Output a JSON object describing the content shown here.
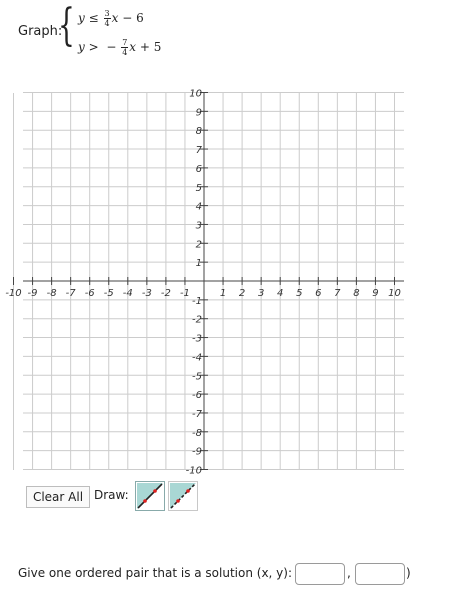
{
  "question": {
    "graph_label": "Graph:",
    "inequality_1": {
      "lhs": "y",
      "op": "≤",
      "num": "3",
      "den": "4",
      "var": "x",
      "rest": "− 6"
    },
    "inequality_2": {
      "lhs": "y",
      "op": ">",
      "sign": "−",
      "num": "7",
      "den": "4",
      "var": "x",
      "rest": "+ 5"
    }
  },
  "grid": {
    "x_ticks": [
      "-10",
      "-9",
      "-8",
      "-7",
      "-6",
      "-5",
      "-4",
      "-3",
      "-2",
      "-1",
      "1",
      "2",
      "3",
      "4",
      "5",
      "6",
      "7",
      "8",
      "9",
      "10"
    ],
    "y_ticks": [
      "10",
      "9",
      "8",
      "7",
      "6",
      "5",
      "4",
      "3",
      "2",
      "1",
      "-1",
      "-2",
      "-3",
      "-4",
      "-5",
      "-6",
      "-7",
      "-8",
      "-9",
      "-10"
    ],
    "x_range": [
      -10,
      10
    ],
    "y_range": [
      -10,
      10
    ]
  },
  "controls": {
    "clear_label": "Clear All",
    "draw_label": "Draw:",
    "tools": [
      {
        "name": "solid-line-tool",
        "icon": "solid-line-icon"
      },
      {
        "name": "dashed-line-tool",
        "icon": "dashed-line-icon"
      }
    ]
  },
  "answer": {
    "prompt": "Give one ordered pair that is a solution (x, y): (",
    "comma": ",",
    "close": ")",
    "x_value": "",
    "y_value": ""
  },
  "colors": {
    "grid_line": "#cccccc",
    "axis": "#444444",
    "tool_fill": "#a9d7d4",
    "point": "#e02020"
  }
}
